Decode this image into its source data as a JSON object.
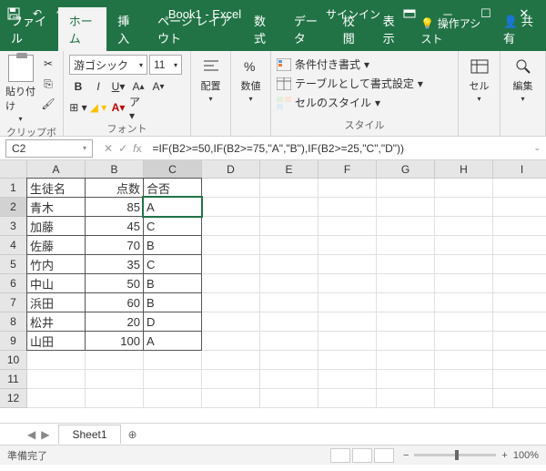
{
  "title": "Book1 - Excel",
  "signin": "サインイン",
  "tabs": {
    "file": "ファイル",
    "home": "ホーム",
    "insert": "挿入",
    "layout": "ページ レイアウト",
    "formulas": "数式",
    "data": "データ",
    "review": "校閲",
    "view": "表示"
  },
  "assist": "操作アシスト",
  "share": "共有",
  "clipboard": {
    "paste": "貼り付け",
    "label": "クリップボード"
  },
  "font": {
    "name": "游ゴシック",
    "size": "11",
    "label": "フォント"
  },
  "align": {
    "label": "配置",
    "btn": "配置"
  },
  "number": {
    "label": "数値",
    "btn": "数値"
  },
  "styles": {
    "cond": "条件付き書式",
    "table": "テーブルとして書式設定",
    "cell": "セルのスタイル",
    "label": "スタイル"
  },
  "cells": {
    "btn": "セル"
  },
  "edit": {
    "btn": "編集"
  },
  "namebox": "C2",
  "formula": "=IF(B2>=50,IF(B2>=75,\"A\",\"B\"),IF(B2>=25,\"C\",\"D\"))",
  "cols": [
    "A",
    "B",
    "C",
    "D",
    "E",
    "F",
    "G",
    "H",
    "I"
  ],
  "rows": [
    "1",
    "2",
    "3",
    "4",
    "5",
    "6",
    "7",
    "8",
    "9",
    "10",
    "11",
    "12"
  ],
  "headers": {
    "a": "生徒名",
    "b": "点数",
    "c": "合否"
  },
  "data_rows": [
    {
      "a": "青木",
      "b": "85",
      "c": "A"
    },
    {
      "a": "加藤",
      "b": "45",
      "c": "C"
    },
    {
      "a": "佐藤",
      "b": "70",
      "c": "B"
    },
    {
      "a": "竹内",
      "b": "35",
      "c": "C"
    },
    {
      "a": "中山",
      "b": "50",
      "c": "B"
    },
    {
      "a": "浜田",
      "b": "60",
      "c": "B"
    },
    {
      "a": "松井",
      "b": "20",
      "c": "D"
    },
    {
      "a": "山田",
      "b": "100",
      "c": "A"
    }
  ],
  "sheet": "Sheet1",
  "status": "準備完了",
  "zoom": "100%"
}
